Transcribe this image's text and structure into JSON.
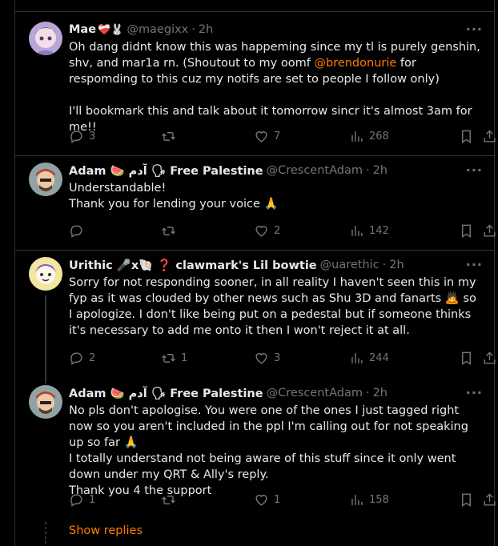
{
  "tweets": [
    {
      "name": "Mae",
      "name_emojis": "❤️‍🩹🐰",
      "handle": "@maegixx",
      "time": "2h",
      "text_1": "Oh dang didnt know this was happeming since my tl is purely genshin, shv, and mar1a rn. (Shoutout to my oomf ",
      "mention": "@brendonurie",
      "text_2": " for respomding to this cuz my notifs are set to people I follow only)",
      "text_3": "I'll bookmark this and talk about it tomorrow sincr it's almost 3am for me!!",
      "replies": "3",
      "retweets": "",
      "likes": "7",
      "views": "268"
    },
    {
      "name": "Adam 🍉 آدم 🗣 Free Palestine",
      "handle": "@CrescentAdam",
      "time": "2h",
      "text_1": "Understandable!",
      "text_2": "Thank you for lending your voice 🙏",
      "replies": "",
      "retweets": "",
      "likes": "2",
      "views": "142"
    },
    {
      "name": "Urithic 🎤x🐚 ❓ clawmark's Lil bowtie",
      "handle": "@uarethic",
      "time": "2h",
      "text_1": "Sorry for not responding sooner, in all reality I haven't seen this in my fyp as it was clouded by other news such as Shu 3D and fanarts 🙇 so I apologize. I don't like being put on a pedestal but if someone thinks it's necessary to add me onto it then I won't reject it at all.",
      "replies": "2",
      "retweets": "1",
      "likes": "3",
      "views": "244"
    },
    {
      "name": "Adam 🍉 آدم 🗣 Free Palestine",
      "handle": "@CrescentAdam",
      "time": "2h",
      "text_1": "No pls don't apologise. You were one of the ones I just tagged right now so you aren't included in the ppl I'm calling out for not speaking up so far 🙏",
      "text_2": "I totally understand not being aware of this stuff since it only went down under my QRT & Ally's reply.",
      "text_3": "Thank you 4 the support",
      "replies": "1",
      "retweets": "",
      "likes": "1",
      "views": "158"
    }
  ],
  "show_replies": "Show replies",
  "more_label": "···",
  "dot": "·",
  "colors": {
    "accent": "#ff7a00",
    "muted": "#71767b",
    "text": "#e7e9ea",
    "border": "#2f3336"
  }
}
